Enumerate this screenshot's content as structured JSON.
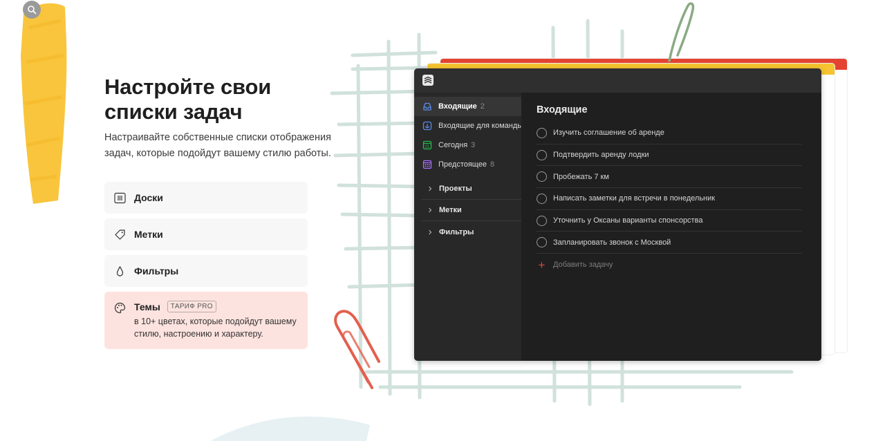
{
  "heading": {
    "line1": "Настройте свои",
    "line2": "списки задач",
    "subtitle": "Настраивайте собственные списки отображения задач, которые подойдут вашему стилю работы."
  },
  "features": [
    {
      "icon": "board-icon",
      "label": "Доски"
    },
    {
      "icon": "tag-icon",
      "label": "Метки"
    },
    {
      "icon": "drop-icon",
      "label": "Фильтры"
    },
    {
      "icon": "palette-icon",
      "label": "Темы",
      "badge": "ТАРИФ PRO",
      "description": "в 10+ цветах, которые подойдут вашему стилю, настроению и характеру."
    }
  ],
  "app": {
    "sidebar": {
      "items": [
        {
          "label": "Входящие",
          "count": "2",
          "icon": "inbox-icon",
          "color": "#5b8def"
        },
        {
          "label": "Входящие для команды",
          "count": "",
          "icon": "team-inbox-icon",
          "color": "#5b8def"
        },
        {
          "label": "Сегодня",
          "count": "3",
          "icon": "calendar-today-icon",
          "color": "#25b84c"
        },
        {
          "label": "Предстоящее",
          "count": "8",
          "icon": "calendar-upcoming-icon",
          "color": "#a970ff"
        }
      ],
      "sections": [
        "Проекты",
        "Метки",
        "Фильтры"
      ]
    },
    "main": {
      "title": "Входящие",
      "tasks": [
        "Изучить соглашение об аренде",
        "Подтвердить аренду лодки",
        "Пробежать 7 км",
        "Написать заметки для встречи в понедельник",
        "Уточнить у Оксаны варианты спонсорства",
        "Запланировать звонок с Москвой"
      ],
      "add_task_label": "Добавить задачу"
    }
  },
  "colors": {
    "accent_red": "#e44332",
    "accent_yellow": "#f5c430",
    "active_feature_bg": "#fde3df"
  }
}
